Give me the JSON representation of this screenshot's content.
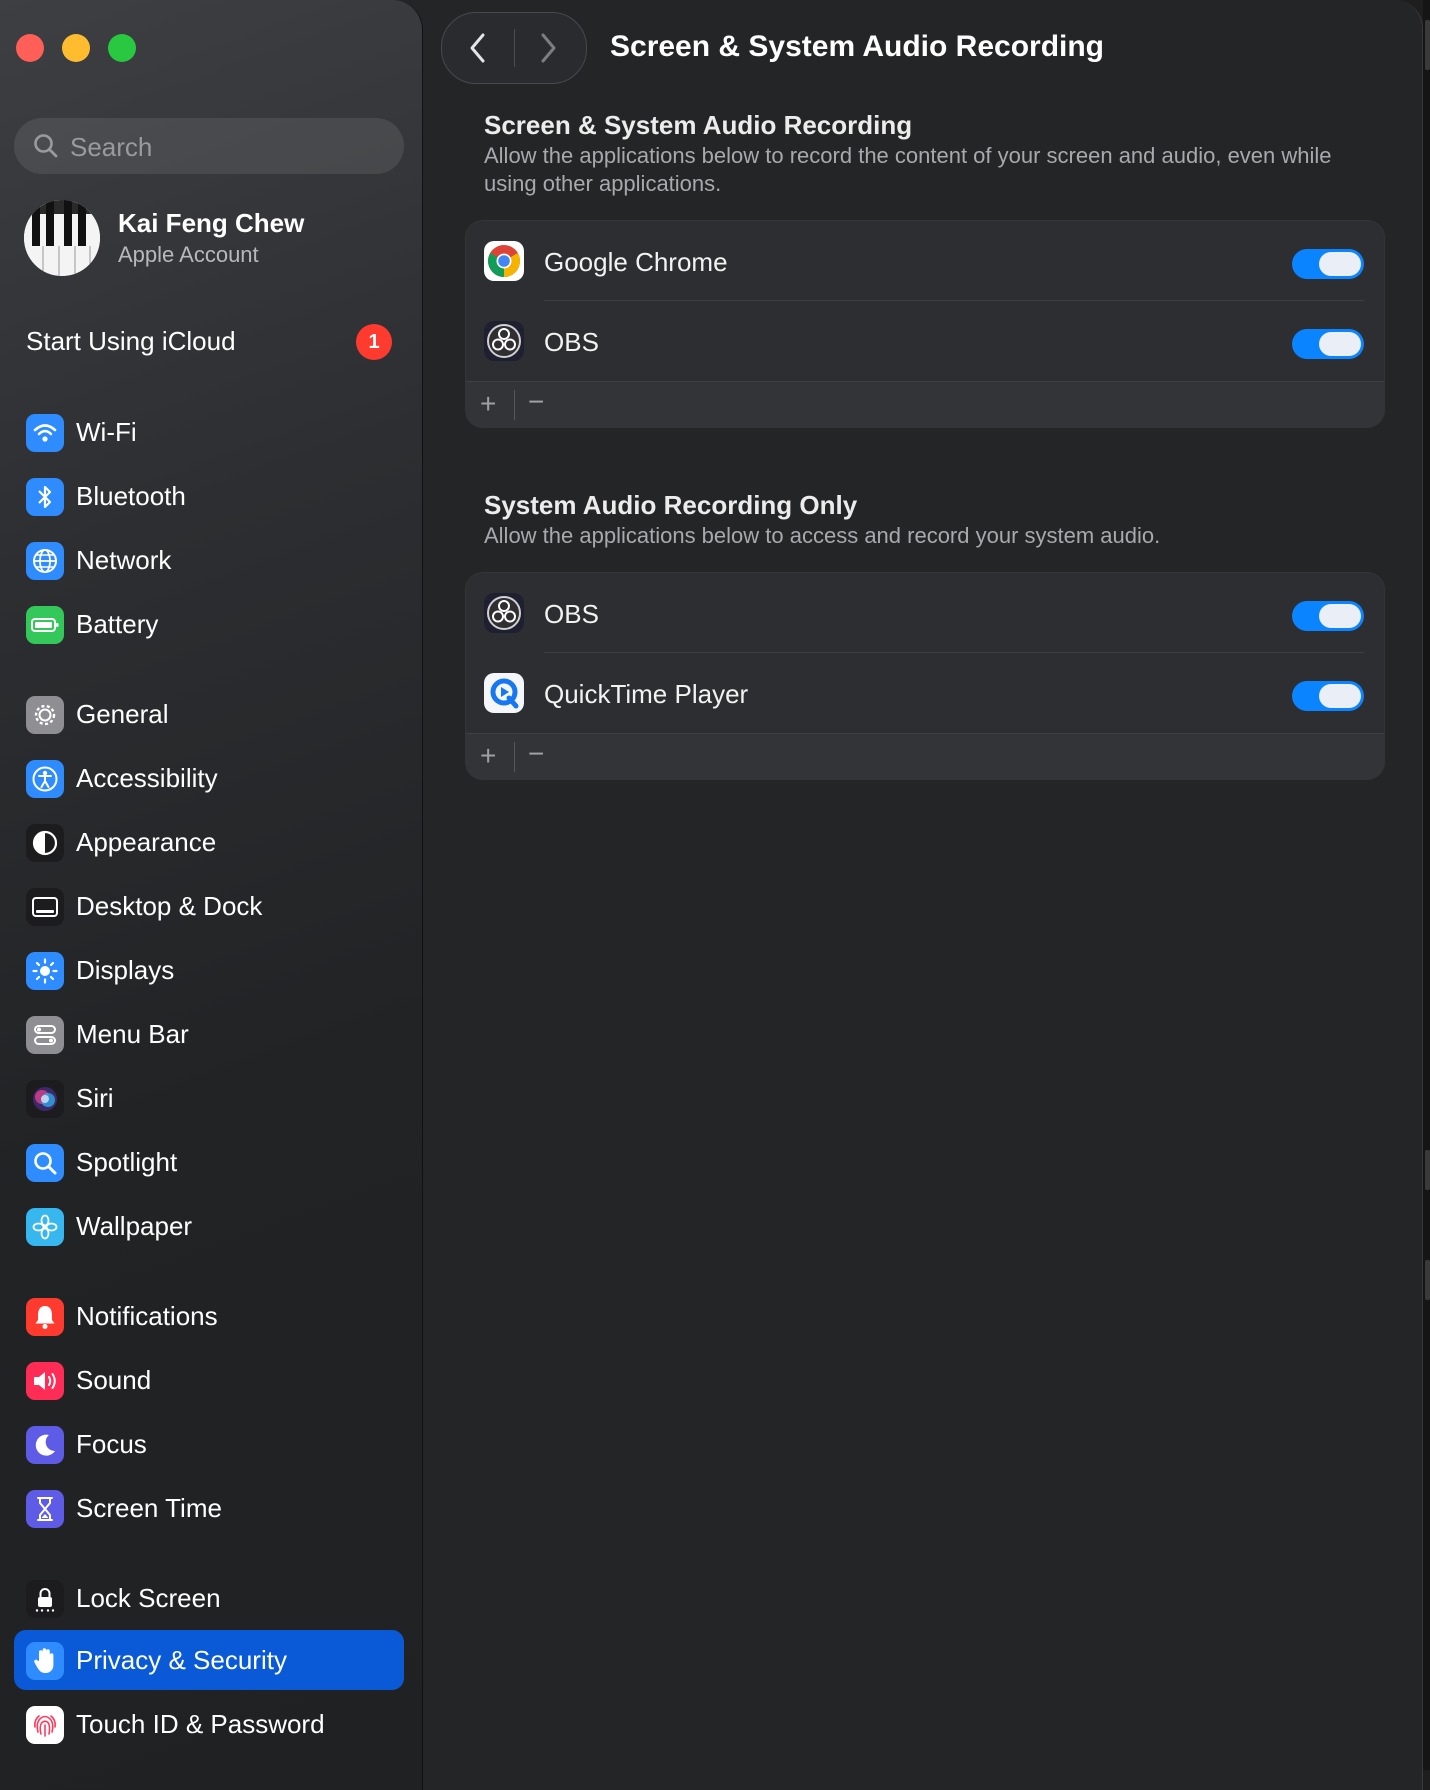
{
  "window": {
    "title": "Screen & System Audio Recording"
  },
  "sidebar": {
    "search_placeholder": "Search",
    "account": {
      "name": "Kai Feng Chew",
      "subtitle": "Apple Account"
    },
    "icloud": {
      "label": "Start Using iCloud",
      "badge": "1"
    },
    "items": [
      {
        "label": "Wi-Fi",
        "icon": "wifi-icon",
        "color": "#2f8cff"
      },
      {
        "label": "Bluetooth",
        "icon": "bluetooth-icon",
        "color": "#2f8cff"
      },
      {
        "label": "Network",
        "icon": "globe-icon",
        "color": "#2f8cff"
      },
      {
        "label": "Battery",
        "icon": "battery-icon",
        "color": "#34c759"
      },
      {
        "label": "General",
        "icon": "gear-icon",
        "color": "#8e8e93"
      },
      {
        "label": "Accessibility",
        "icon": "accessibility-icon",
        "color": "#2f8cff"
      },
      {
        "label": "Appearance",
        "icon": "appearance-icon",
        "color": "#1c1c1e"
      },
      {
        "label": "Desktop & Dock",
        "icon": "dock-icon",
        "color": "#1c1c1e"
      },
      {
        "label": "Displays",
        "icon": "sun-icon",
        "color": "#2f8cff"
      },
      {
        "label": "Menu Bar",
        "icon": "menubar-icon",
        "color": "#8e8e93"
      },
      {
        "label": "Siri",
        "icon": "siri-icon",
        "color": "#1c1c1e"
      },
      {
        "label": "Spotlight",
        "icon": "magnifier-icon",
        "color": "#2f8cff"
      },
      {
        "label": "Wallpaper",
        "icon": "flower-icon",
        "color": "#36b7f0"
      },
      {
        "label": "Notifications",
        "icon": "bell-icon",
        "color": "#ff3b30"
      },
      {
        "label": "Sound",
        "icon": "speaker-icon",
        "color": "#ff2d55"
      },
      {
        "label": "Focus",
        "icon": "moon-icon",
        "color": "#5e5ce6"
      },
      {
        "label": "Screen Time",
        "icon": "hourglass-icon",
        "color": "#5e5ce6"
      },
      {
        "label": "Lock Screen",
        "icon": "lock-icon",
        "color": "#1c1c1e"
      },
      {
        "label": "Privacy & Security",
        "icon": "hand-icon",
        "color": "#2f8cff",
        "selected": true
      },
      {
        "label": "Touch ID & Password",
        "icon": "fingerprint-icon",
        "color": "#ffffff"
      }
    ]
  },
  "main": {
    "title": "Screen & System Audio Recording",
    "sections": [
      {
        "title": "Screen & System Audio Recording",
        "description": "Allow the applications below to record the content of your screen and audio, even while using other applications.",
        "apps": [
          {
            "name": "Google Chrome",
            "icon": "chrome-icon",
            "enabled": true
          },
          {
            "name": "OBS",
            "icon": "obs-icon",
            "enabled": true
          }
        ]
      },
      {
        "title": "System Audio Recording Only",
        "description": "Allow the applications below to access and record your system audio.",
        "apps": [
          {
            "name": "OBS",
            "icon": "obs-icon",
            "enabled": true
          },
          {
            "name": "QuickTime Player",
            "icon": "quicktime-icon",
            "enabled": true
          }
        ]
      }
    ],
    "footer": {
      "add": "+",
      "remove": "−"
    }
  },
  "colors": {
    "accent": "#0a84ff",
    "selected_row": "#0a5ad8",
    "badge": "#ff3b30"
  }
}
